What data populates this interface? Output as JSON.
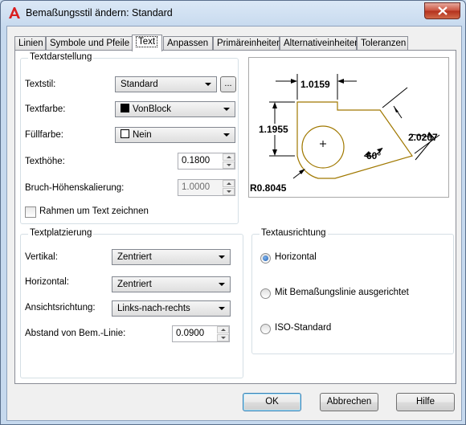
{
  "window": {
    "title": "Bemaßungsstil ändern: Standard"
  },
  "tabs": [
    {
      "label": "Linien",
      "active": false
    },
    {
      "label": "Symbole und Pfeile",
      "active": false
    },
    {
      "label": "Text",
      "active": true
    },
    {
      "label": "Anpassen",
      "active": false
    },
    {
      "label": "Primäreinheiten",
      "active": false
    },
    {
      "label": "Alternativeinheiten",
      "active": false
    },
    {
      "label": "Toleranzen",
      "active": false
    }
  ],
  "textdarstellung": {
    "legend": "Textdarstellung",
    "textstil_label": "Textstil:",
    "textstil_value": "Standard",
    "textstil_browse": "...",
    "textfarbe_label": "Textfarbe:",
    "textfarbe_value": "VonBlock",
    "textfarbe_swatch": "#000000",
    "fuellfarbe_label": "Füllfarbe:",
    "fuellfarbe_value": "Nein",
    "fuellfarbe_swatch": "#ffffff",
    "texthoehe_label": "Texthöhe:",
    "texthoehe_value": "0.1800",
    "bruch_label": "Bruch-Höhenskalierung:",
    "bruch_value": "1.0000",
    "rahmen_label": "Rahmen um Text zeichnen",
    "rahmen_checked": false
  },
  "preview": {
    "dim_top": "1.0159",
    "dim_left": "1.1955",
    "dim_right": "2.0207",
    "angle": "60°",
    "radius": "R0.8045",
    "geometry_color": "#a07800"
  },
  "textplatzierung": {
    "legend": "Textplatzierung",
    "vertikal_label": "Vertikal:",
    "vertikal_value": "Zentriert",
    "horizontal_label": "Horizontal:",
    "horizontal_value": "Zentriert",
    "ansicht_label": "Ansichtsrichtung:",
    "ansicht_value": "Links-nach-rechts",
    "abstand_label": "Abstand von Bem.-Linie:",
    "abstand_value": "0.0900"
  },
  "textausrichtung": {
    "legend": "Textausrichtung",
    "options": [
      {
        "label": "Horizontal",
        "checked": true
      },
      {
        "label": "Mit Bemaßungslinie ausgerichtet",
        "checked": false
      },
      {
        "label": "ISO-Standard",
        "checked": false
      }
    ]
  },
  "buttons": {
    "ok": "OK",
    "cancel": "Abbrechen",
    "help": "Hilfe"
  }
}
